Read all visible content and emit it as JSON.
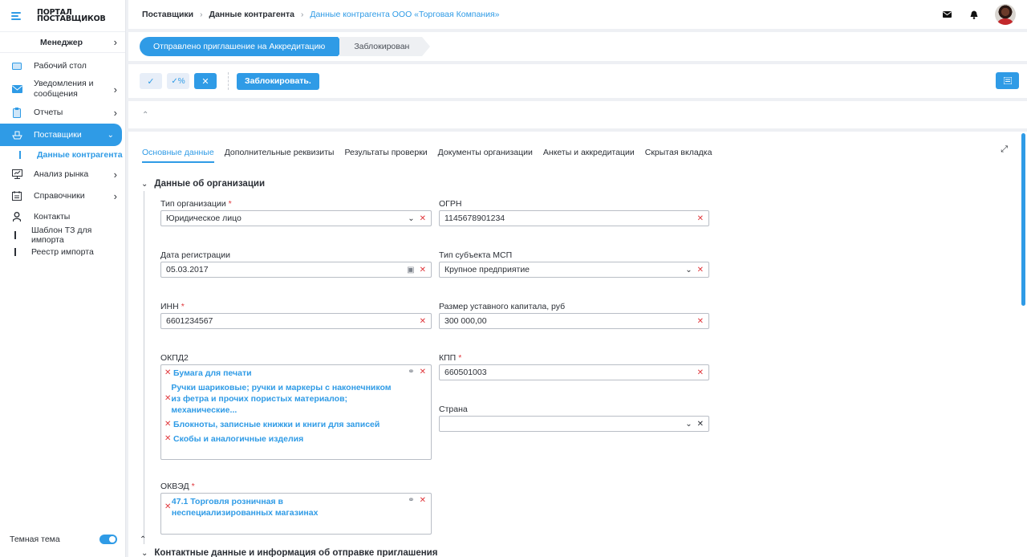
{
  "app": {
    "logo_line1": "ПОРТАЛ",
    "logo_line2": "ПОСТАВЩИКОВ"
  },
  "sidebar": {
    "role": "Менеджер",
    "items": [
      {
        "label": "Рабочий стол",
        "icon": "desktop-icon"
      },
      {
        "label": "Уведомления и сообщения",
        "icon": "mail-icon"
      },
      {
        "label": "Отчеты",
        "icon": "clipboard-icon"
      },
      {
        "label": "Поставщики",
        "icon": "ship-icon"
      },
      {
        "label": "Анализ рынка",
        "icon": "chart-board-icon"
      },
      {
        "label": "Справочники",
        "icon": "calendar-list-icon"
      },
      {
        "label": "Контакты",
        "icon": "person-icon"
      }
    ],
    "sub_item": "Данные контрагента",
    "plain_items": [
      "Шаблон ТЗ для импорта",
      "Реестр импорта"
    ],
    "theme_label": "Темная тема"
  },
  "breadcrumb": {
    "level1": "Поставщики",
    "level2": "Данные контрагента",
    "current": "Данные контрагента ООО «Торговая Компания»"
  },
  "status": {
    "active": "Отправлено приглашение на Аккредитацию",
    "next": "Заблокирован"
  },
  "toolbar": {
    "block_label": "Заблокировать."
  },
  "tabs": [
    "Основные данные",
    "Дополнительные реквизиты",
    "Результаты проверки",
    "Документы организации",
    "Анкеты и аккредитации",
    "Скрытая вкладка"
  ],
  "section": {
    "title": "Данные об организации",
    "next_title": "Контактные данные и информация об отправке приглашения"
  },
  "form": {
    "org_type": {
      "label": "Тип организации",
      "value": "Юридическое лицо"
    },
    "ogrn": {
      "label": "ОГРН",
      "value": "1145678901234"
    },
    "reg_date": {
      "label": "Дата регистрации",
      "value": "05.03.2017"
    },
    "msp_type": {
      "label": "Тип субъекта МСП",
      "value": "Крупное предприятие"
    },
    "inn": {
      "label": "ИНН",
      "value": "6601234567"
    },
    "capital": {
      "label": "Размер уставного капитала, руб",
      "value": "300 000,00"
    },
    "okpd2": {
      "label": "ОКПД2",
      "items": [
        "Бумага для печати",
        "Ручки шариковые; ручки и маркеры с наконечником из фетра и прочих пористых материалов; механические...",
        "Блокноты, записные книжки и книги для записей",
        "Скобы и аналогичные изделия"
      ]
    },
    "kpp": {
      "label": "КПП",
      "value": "660501003"
    },
    "country": {
      "label": "Страна",
      "value": ""
    },
    "okved": {
      "label": "ОКВЭД",
      "items": [
        "47.1 Торговля розничная в неспециализированных магазинах"
      ]
    }
  },
  "colors": {
    "accent": "#2f9be6",
    "required": "#e0363b"
  }
}
